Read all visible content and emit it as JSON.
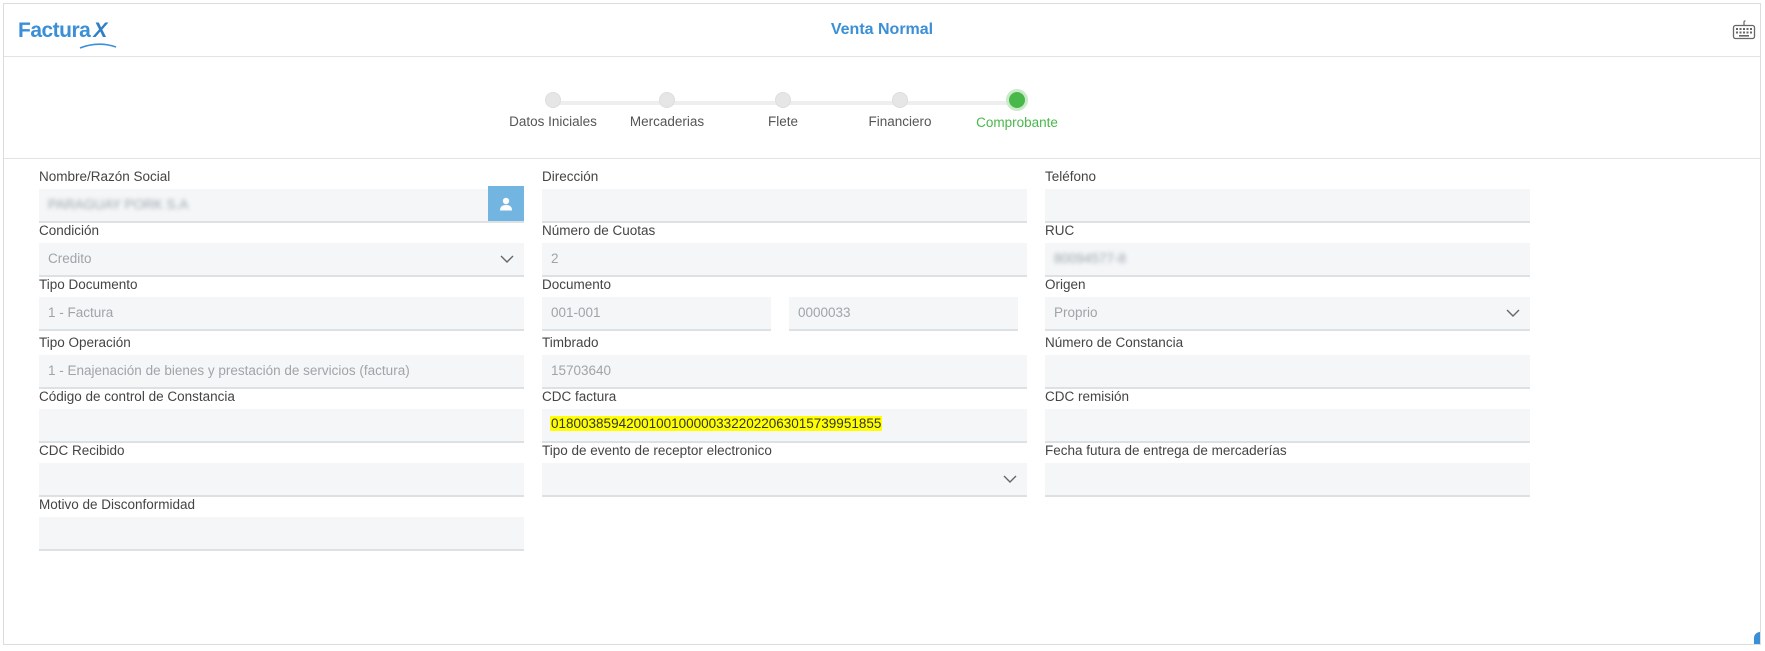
{
  "header": {
    "logo_text": "Factura",
    "logo_x": "X",
    "title": "Venta Normal",
    "keyboard_icon": "keyboard-icon"
  },
  "stepper": {
    "steps": [
      {
        "label": "Datos Iniciales",
        "active": false
      },
      {
        "label": "Mercaderias",
        "active": false
      },
      {
        "label": "Flete",
        "active": false
      },
      {
        "label": "Financiero",
        "active": false
      },
      {
        "label": "Comprobante",
        "active": true
      }
    ],
    "active_color": "#49b84a"
  },
  "form": {
    "nombre": {
      "label": "Nombre/Razón Social",
      "value": "PARAGUAY PORK S.A"
    },
    "direccion": {
      "label": "Dirección",
      "value": ""
    },
    "telefono": {
      "label": "Teléfono",
      "value": ""
    },
    "condicion": {
      "label": "Condición",
      "value": "Credito"
    },
    "cuotas": {
      "label": "Número de Cuotas",
      "value": "2"
    },
    "ruc": {
      "label": "RUC",
      "value": "80094577-8"
    },
    "tipo_documento": {
      "label": "Tipo Documento",
      "value": "1 - Factura"
    },
    "documento": {
      "label": "Documento",
      "value_a": "001-001",
      "value_b": "0000033"
    },
    "origen": {
      "label": "Origen",
      "value": "Proprio"
    },
    "tipo_operacion": {
      "label": "Tipo Operación",
      "value": "1 - Enajenación de bienes y prestación de servicios (factura)"
    },
    "timbrado": {
      "label": "Timbrado",
      "value": "15703640"
    },
    "numero_constancia": {
      "label": "Número de Constancia",
      "value": ""
    },
    "codigo_control": {
      "label": "Código de control de Constancia",
      "value": ""
    },
    "cdc_factura": {
      "label": "CDC factura",
      "value": "01800385942001001000003322022063015739951855"
    },
    "cdc_remision": {
      "label": "CDC remisión",
      "value": ""
    },
    "cdc_recibido": {
      "label": "CDC Recibido",
      "value": ""
    },
    "tipo_evento": {
      "label": "Tipo de evento de receptor electronico",
      "value": ""
    },
    "fecha_futura": {
      "label": "Fecha futura de entrega de mercaderías",
      "value": ""
    },
    "motivo": {
      "label": "Motivo de Disconformidad",
      "value": ""
    }
  },
  "colors": {
    "brand": "#3a8fd6",
    "highlight": "#ffff00",
    "user_button": "#72b5e0"
  }
}
